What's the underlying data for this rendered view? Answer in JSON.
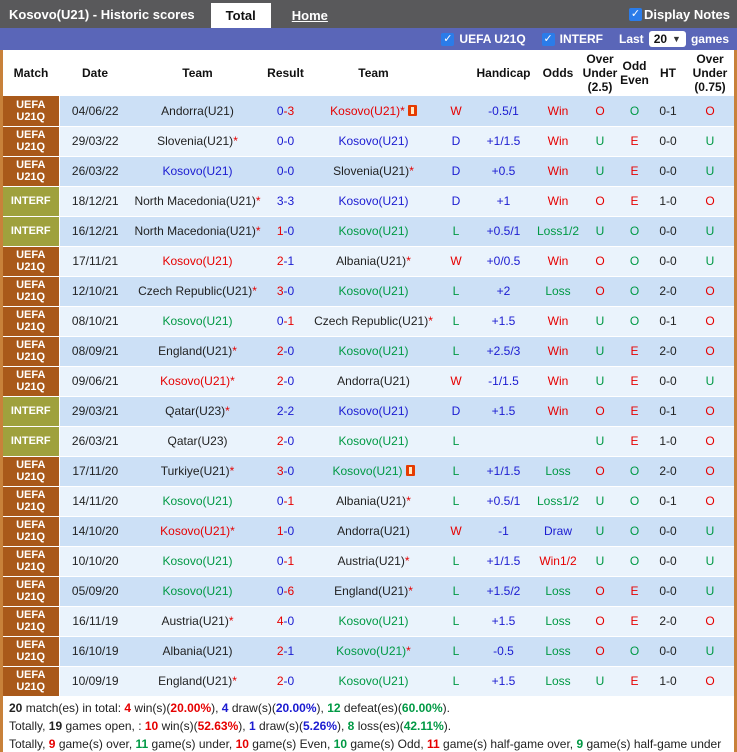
{
  "palette": {
    "r": "#e60000",
    "b": "#1b1bd1",
    "g": "#009944",
    "k": "#222222"
  },
  "topbar": {
    "title": "Kosovo(U21) - Historic scores",
    "tabs": [
      {
        "label": "Total",
        "active": true
      },
      {
        "label": "Home",
        "active": false
      }
    ],
    "display_notes": {
      "label": "Display Notes",
      "checked": true
    }
  },
  "filterbar": {
    "checkboxes": [
      {
        "label": "UEFA U21Q",
        "checked": true
      },
      {
        "label": "INTERF",
        "checked": true
      }
    ],
    "last_label": "Last",
    "last_value": "20",
    "games_label": "games"
  },
  "table": {
    "headers": [
      "Match",
      "Date",
      "Team",
      "Result",
      "Team",
      "",
      "Handicap",
      "Odds",
      "Over Under (2.5)",
      "Odd Even",
      "HT",
      "Over Under (0.75)"
    ],
    "rows": [
      {
        "lg": "UEFA U21Q",
        "lgc": "uefa",
        "date": "04/06/22",
        "t1": {
          "n": "Andorra(U21)",
          "s": false,
          "c": "k"
        },
        "res": {
          "h": "0",
          "hc": "b",
          "a": "3",
          "ac": "r"
        },
        "t2": {
          "n": "Kosovo(U21)",
          "s": true,
          "c": "r",
          "card": true
        },
        "wdl": {
          "t": "W",
          "c": "r"
        },
        "hcp": "-0.5/1",
        "odds": {
          "t": "Win",
          "c": "r"
        },
        "ou": {
          "t": "O",
          "c": "r"
        },
        "oe": {
          "t": "O",
          "c": "g"
        },
        "ht": "0-1",
        "ou2": {
          "t": "O",
          "c": "r"
        }
      },
      {
        "lg": "UEFA U21Q",
        "lgc": "uefa",
        "date": "29/03/22",
        "t1": {
          "n": "Slovenia(U21)",
          "s": true,
          "c": "k"
        },
        "res": {
          "h": "0",
          "hc": "b",
          "a": "0",
          "ac": "b"
        },
        "t2": {
          "n": "Kosovo(U21)",
          "s": false,
          "c": "b"
        },
        "wdl": {
          "t": "D",
          "c": "b"
        },
        "hcp": "+1/1.5",
        "odds": {
          "t": "Win",
          "c": "r"
        },
        "ou": {
          "t": "U",
          "c": "g"
        },
        "oe": {
          "t": "E",
          "c": "r"
        },
        "ht": "0-0",
        "ou2": {
          "t": "U",
          "c": "g"
        }
      },
      {
        "lg": "UEFA U21Q",
        "lgc": "uefa",
        "date": "26/03/22",
        "t1": {
          "n": "Kosovo(U21)",
          "s": false,
          "c": "b"
        },
        "res": {
          "h": "0",
          "hc": "b",
          "a": "0",
          "ac": "b"
        },
        "t2": {
          "n": "Slovenia(U21)",
          "s": true,
          "c": "k"
        },
        "wdl": {
          "t": "D",
          "c": "b"
        },
        "hcp": "+0.5",
        "odds": {
          "t": "Win",
          "c": "r"
        },
        "ou": {
          "t": "U",
          "c": "g"
        },
        "oe": {
          "t": "E",
          "c": "r"
        },
        "ht": "0-0",
        "ou2": {
          "t": "U",
          "c": "g"
        }
      },
      {
        "lg": "INTERF",
        "lgc": "interf",
        "date": "18/12/21",
        "t1": {
          "n": "North Macedonia(U21)",
          "s": true,
          "c": "k"
        },
        "res": {
          "h": "3",
          "hc": "b",
          "a": "3",
          "ac": "b"
        },
        "t2": {
          "n": "Kosovo(U21)",
          "s": false,
          "c": "b"
        },
        "wdl": {
          "t": "D",
          "c": "b"
        },
        "hcp": "+1",
        "odds": {
          "t": "Win",
          "c": "r"
        },
        "ou": {
          "t": "O",
          "c": "r"
        },
        "oe": {
          "t": "E",
          "c": "r"
        },
        "ht": "1-0",
        "ou2": {
          "t": "O",
          "c": "r"
        }
      },
      {
        "lg": "INTERF",
        "lgc": "interf",
        "date": "16/12/21",
        "t1": {
          "n": "North Macedonia(U21)",
          "s": true,
          "c": "k"
        },
        "res": {
          "h": "1",
          "hc": "r",
          "a": "0",
          "ac": "b"
        },
        "t2": {
          "n": "Kosovo(U21)",
          "s": false,
          "c": "g"
        },
        "wdl": {
          "t": "L",
          "c": "g"
        },
        "hcp": "+0.5/1",
        "odds": {
          "t": "Loss1/2",
          "c": "g"
        },
        "ou": {
          "t": "U",
          "c": "g"
        },
        "oe": {
          "t": "O",
          "c": "g"
        },
        "ht": "0-0",
        "ou2": {
          "t": "U",
          "c": "g"
        }
      },
      {
        "lg": "UEFA U21Q",
        "lgc": "uefa",
        "date": "17/11/21",
        "t1": {
          "n": "Kosovo(U21)",
          "s": false,
          "c": "r"
        },
        "res": {
          "h": "2",
          "hc": "r",
          "a": "1",
          "ac": "b"
        },
        "t2": {
          "n": "Albania(U21)",
          "s": true,
          "c": "k"
        },
        "wdl": {
          "t": "W",
          "c": "r"
        },
        "hcp": "+0/0.5",
        "odds": {
          "t": "Win",
          "c": "r"
        },
        "ou": {
          "t": "O",
          "c": "r"
        },
        "oe": {
          "t": "O",
          "c": "g"
        },
        "ht": "0-0",
        "ou2": {
          "t": "U",
          "c": "g"
        }
      },
      {
        "lg": "UEFA U21Q",
        "lgc": "uefa",
        "date": "12/10/21",
        "t1": {
          "n": "Czech Republic(U21)",
          "s": true,
          "c": "k"
        },
        "res": {
          "h": "3",
          "hc": "r",
          "a": "0",
          "ac": "b"
        },
        "t2": {
          "n": "Kosovo(U21)",
          "s": false,
          "c": "g"
        },
        "wdl": {
          "t": "L",
          "c": "g"
        },
        "hcp": "+2",
        "odds": {
          "t": "Loss",
          "c": "g"
        },
        "ou": {
          "t": "O",
          "c": "r"
        },
        "oe": {
          "t": "O",
          "c": "g"
        },
        "ht": "2-0",
        "ou2": {
          "t": "O",
          "c": "r"
        }
      },
      {
        "lg": "UEFA U21Q",
        "lgc": "uefa",
        "date": "08/10/21",
        "t1": {
          "n": "Kosovo(U21)",
          "s": false,
          "c": "g"
        },
        "res": {
          "h": "0",
          "hc": "b",
          "a": "1",
          "ac": "r"
        },
        "t2": {
          "n": "Czech Republic(U21)",
          "s": true,
          "c": "k"
        },
        "wdl": {
          "t": "L",
          "c": "g"
        },
        "hcp": "+1.5",
        "odds": {
          "t": "Win",
          "c": "r"
        },
        "ou": {
          "t": "U",
          "c": "g"
        },
        "oe": {
          "t": "O",
          "c": "g"
        },
        "ht": "0-1",
        "ou2": {
          "t": "O",
          "c": "r"
        }
      },
      {
        "lg": "UEFA U21Q",
        "lgc": "uefa",
        "date": "08/09/21",
        "t1": {
          "n": "England(U21)",
          "s": true,
          "c": "k"
        },
        "res": {
          "h": "2",
          "hc": "r",
          "a": "0",
          "ac": "b"
        },
        "t2": {
          "n": "Kosovo(U21)",
          "s": false,
          "c": "g"
        },
        "wdl": {
          "t": "L",
          "c": "g"
        },
        "hcp": "+2.5/3",
        "odds": {
          "t": "Win",
          "c": "r"
        },
        "ou": {
          "t": "U",
          "c": "g"
        },
        "oe": {
          "t": "E",
          "c": "r"
        },
        "ht": "2-0",
        "ou2": {
          "t": "O",
          "c": "r"
        }
      },
      {
        "lg": "UEFA U21Q",
        "lgc": "uefa",
        "date": "09/06/21",
        "t1": {
          "n": "Kosovo(U21)",
          "s": true,
          "c": "r"
        },
        "res": {
          "h": "2",
          "hc": "r",
          "a": "0",
          "ac": "b"
        },
        "t2": {
          "n": "Andorra(U21)",
          "s": false,
          "c": "k"
        },
        "wdl": {
          "t": "W",
          "c": "r"
        },
        "hcp": "-1/1.5",
        "odds": {
          "t": "Win",
          "c": "r"
        },
        "ou": {
          "t": "U",
          "c": "g"
        },
        "oe": {
          "t": "E",
          "c": "r"
        },
        "ht": "0-0",
        "ou2": {
          "t": "U",
          "c": "g"
        }
      },
      {
        "lg": "INTERF",
        "lgc": "interf",
        "date": "29/03/21",
        "t1": {
          "n": "Qatar(U23)",
          "s": true,
          "c": "k"
        },
        "res": {
          "h": "2",
          "hc": "b",
          "a": "2",
          "ac": "b"
        },
        "t2": {
          "n": "Kosovo(U21)",
          "s": false,
          "c": "b"
        },
        "wdl": {
          "t": "D",
          "c": "b"
        },
        "hcp": "+1.5",
        "odds": {
          "t": "Win",
          "c": "r"
        },
        "ou": {
          "t": "O",
          "c": "r"
        },
        "oe": {
          "t": "E",
          "c": "r"
        },
        "ht": "0-1",
        "ou2": {
          "t": "O",
          "c": "r"
        }
      },
      {
        "lg": "INTERF",
        "lgc": "interf",
        "date": "26/03/21",
        "t1": {
          "n": "Qatar(U23)",
          "s": false,
          "c": "k"
        },
        "res": {
          "h": "2",
          "hc": "r",
          "a": "0",
          "ac": "b"
        },
        "t2": {
          "n": "Kosovo(U21)",
          "s": false,
          "c": "g"
        },
        "wdl": {
          "t": "L",
          "c": "g"
        },
        "hcp": "",
        "odds": {
          "t": "",
          "c": "k"
        },
        "ou": {
          "t": "U",
          "c": "g"
        },
        "oe": {
          "t": "E",
          "c": "r"
        },
        "ht": "1-0",
        "ou2": {
          "t": "O",
          "c": "r"
        }
      },
      {
        "lg": "UEFA U21Q",
        "lgc": "uefa",
        "date": "17/11/20",
        "t1": {
          "n": "Turkiye(U21)",
          "s": true,
          "c": "k"
        },
        "res": {
          "h": "3",
          "hc": "r",
          "a": "0",
          "ac": "b"
        },
        "t2": {
          "n": "Kosovo(U21)",
          "s": false,
          "c": "g",
          "card": true
        },
        "wdl": {
          "t": "L",
          "c": "g"
        },
        "hcp": "+1/1.5",
        "odds": {
          "t": "Loss",
          "c": "g"
        },
        "ou": {
          "t": "O",
          "c": "r"
        },
        "oe": {
          "t": "O",
          "c": "g"
        },
        "ht": "2-0",
        "ou2": {
          "t": "O",
          "c": "r"
        }
      },
      {
        "lg": "UEFA U21Q",
        "lgc": "uefa",
        "date": "14/11/20",
        "t1": {
          "n": "Kosovo(U21)",
          "s": false,
          "c": "g"
        },
        "res": {
          "h": "0",
          "hc": "b",
          "a": "1",
          "ac": "r"
        },
        "t2": {
          "n": "Albania(U21)",
          "s": true,
          "c": "k"
        },
        "wdl": {
          "t": "L",
          "c": "g"
        },
        "hcp": "+0.5/1",
        "odds": {
          "t": "Loss1/2",
          "c": "g"
        },
        "ou": {
          "t": "U",
          "c": "g"
        },
        "oe": {
          "t": "O",
          "c": "g"
        },
        "ht": "0-1",
        "ou2": {
          "t": "O",
          "c": "r"
        }
      },
      {
        "lg": "UEFA U21Q",
        "lgc": "uefa",
        "date": "14/10/20",
        "t1": {
          "n": "Kosovo(U21)",
          "s": true,
          "c": "r"
        },
        "res": {
          "h": "1",
          "hc": "r",
          "a": "0",
          "ac": "b"
        },
        "t2": {
          "n": "Andorra(U21)",
          "s": false,
          "c": "k"
        },
        "wdl": {
          "t": "W",
          "c": "r"
        },
        "hcp": "-1",
        "odds": {
          "t": "Draw",
          "c": "b"
        },
        "ou": {
          "t": "U",
          "c": "g"
        },
        "oe": {
          "t": "O",
          "c": "g"
        },
        "ht": "0-0",
        "ou2": {
          "t": "U",
          "c": "g"
        }
      },
      {
        "lg": "UEFA U21Q",
        "lgc": "uefa",
        "date": "10/10/20",
        "t1": {
          "n": "Kosovo(U21)",
          "s": false,
          "c": "g"
        },
        "res": {
          "h": "0",
          "hc": "b",
          "a": "1",
          "ac": "r"
        },
        "t2": {
          "n": "Austria(U21)",
          "s": true,
          "c": "k"
        },
        "wdl": {
          "t": "L",
          "c": "g"
        },
        "hcp": "+1/1.5",
        "odds": {
          "t": "Win1/2",
          "c": "r"
        },
        "ou": {
          "t": "U",
          "c": "g"
        },
        "oe": {
          "t": "O",
          "c": "g"
        },
        "ht": "0-0",
        "ou2": {
          "t": "U",
          "c": "g"
        }
      },
      {
        "lg": "UEFA U21Q",
        "lgc": "uefa",
        "date": "05/09/20",
        "t1": {
          "n": "Kosovo(U21)",
          "s": false,
          "c": "g"
        },
        "res": {
          "h": "0",
          "hc": "b",
          "a": "6",
          "ac": "r"
        },
        "t2": {
          "n": "England(U21)",
          "s": true,
          "c": "k"
        },
        "wdl": {
          "t": "L",
          "c": "g"
        },
        "hcp": "+1.5/2",
        "odds": {
          "t": "Loss",
          "c": "g"
        },
        "ou": {
          "t": "O",
          "c": "r"
        },
        "oe": {
          "t": "E",
          "c": "r"
        },
        "ht": "0-0",
        "ou2": {
          "t": "U",
          "c": "g"
        }
      },
      {
        "lg": "UEFA U21Q",
        "lgc": "uefa",
        "date": "16/11/19",
        "t1": {
          "n": "Austria(U21)",
          "s": true,
          "c": "k"
        },
        "res": {
          "h": "4",
          "hc": "r",
          "a": "0",
          "ac": "b"
        },
        "t2": {
          "n": "Kosovo(U21)",
          "s": false,
          "c": "g"
        },
        "wdl": {
          "t": "L",
          "c": "g"
        },
        "hcp": "+1.5",
        "odds": {
          "t": "Loss",
          "c": "g"
        },
        "ou": {
          "t": "O",
          "c": "r"
        },
        "oe": {
          "t": "E",
          "c": "r"
        },
        "ht": "2-0",
        "ou2": {
          "t": "O",
          "c": "r"
        }
      },
      {
        "lg": "UEFA U21Q",
        "lgc": "uefa",
        "date": "16/10/19",
        "t1": {
          "n": "Albania(U21)",
          "s": false,
          "c": "k"
        },
        "res": {
          "h": "2",
          "hc": "r",
          "a": "1",
          "ac": "b"
        },
        "t2": {
          "n": "Kosovo(U21)",
          "s": true,
          "c": "g"
        },
        "wdl": {
          "t": "L",
          "c": "g"
        },
        "hcp": "-0.5",
        "odds": {
          "t": "Loss",
          "c": "g"
        },
        "ou": {
          "t": "O",
          "c": "r"
        },
        "oe": {
          "t": "O",
          "c": "g"
        },
        "ht": "0-0",
        "ou2": {
          "t": "U",
          "c": "g"
        }
      },
      {
        "lg": "UEFA U21Q",
        "lgc": "uefa",
        "date": "10/09/19",
        "t1": {
          "n": "England(U21)",
          "s": true,
          "c": "k"
        },
        "res": {
          "h": "2",
          "hc": "r",
          "a": "0",
          "ac": "b"
        },
        "t2": {
          "n": "Kosovo(U21)",
          "s": false,
          "c": "g"
        },
        "wdl": {
          "t": "L",
          "c": "g"
        },
        "hcp": "+1.5",
        "odds": {
          "t": "Loss",
          "c": "g"
        },
        "ou": {
          "t": "U",
          "c": "g"
        },
        "oe": {
          "t": "E",
          "c": "r"
        },
        "ht": "1-0",
        "ou2": {
          "t": "O",
          "c": "r"
        }
      }
    ]
  },
  "footer": {
    "lines": [
      [
        {
          "t": "20",
          "b": true
        },
        {
          "t": " match(es) in total: "
        },
        {
          "t": "4",
          "c": "r",
          "b": true
        },
        {
          "t": " win(s)("
        },
        {
          "t": "20.00%",
          "c": "r",
          "b": true
        },
        {
          "t": "), "
        },
        {
          "t": "4",
          "c": "b",
          "b": true
        },
        {
          "t": " draw(s)("
        },
        {
          "t": "20.00%",
          "c": "b",
          "b": true
        },
        {
          "t": "), "
        },
        {
          "t": "12",
          "c": "g",
          "b": true
        },
        {
          "t": " defeat(es)("
        },
        {
          "t": "60.00%",
          "c": "g",
          "b": true
        },
        {
          "t": ")."
        }
      ],
      [
        {
          "t": "Totally, "
        },
        {
          "t": "19",
          "b": true
        },
        {
          "t": " games open, : "
        },
        {
          "t": "10",
          "c": "r",
          "b": true
        },
        {
          "t": " win(s)("
        },
        {
          "t": "52.63%",
          "c": "r",
          "b": true
        },
        {
          "t": "), "
        },
        {
          "t": "1",
          "c": "b",
          "b": true
        },
        {
          "t": " draw(s)("
        },
        {
          "t": "5.26%",
          "c": "b",
          "b": true
        },
        {
          "t": "), "
        },
        {
          "t": "8",
          "c": "g",
          "b": true
        },
        {
          "t": " loss(es)("
        },
        {
          "t": "42.11%",
          "c": "g",
          "b": true
        },
        {
          "t": ")."
        }
      ],
      [
        {
          "t": "Totally, "
        },
        {
          "t": "9",
          "c": "r",
          "b": true
        },
        {
          "t": " game(s) over, "
        },
        {
          "t": "11",
          "c": "g",
          "b": true
        },
        {
          "t": " game(s) under, "
        },
        {
          "t": "10",
          "c": "r",
          "b": true
        },
        {
          "t": " game(s) Even, "
        },
        {
          "t": "10",
          "c": "g",
          "b": true
        },
        {
          "t": " game(s) Odd, "
        },
        {
          "t": "11",
          "c": "r",
          "b": true
        },
        {
          "t": " game(s) half-game over, "
        },
        {
          "t": "9",
          "c": "g",
          "b": true
        },
        {
          "t": " game(s) half-game under"
        }
      ]
    ]
  }
}
